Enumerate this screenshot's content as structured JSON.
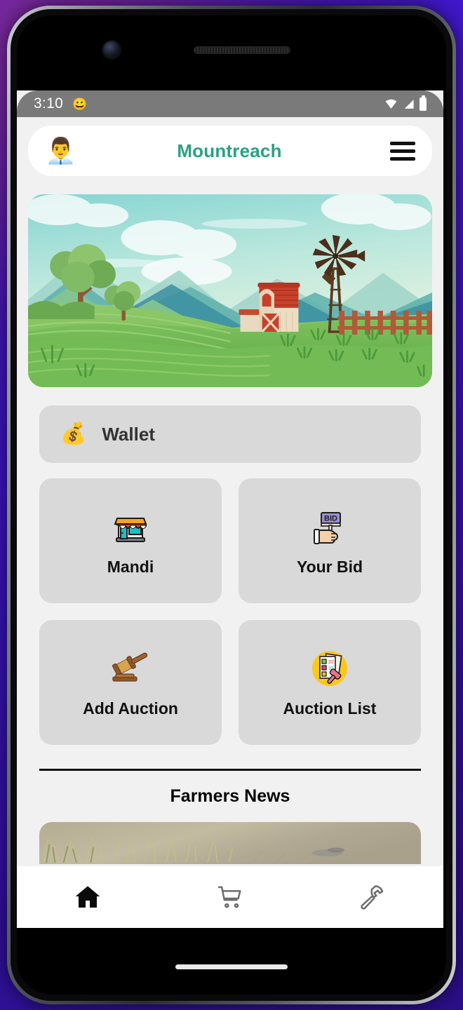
{
  "status_bar": {
    "time": "3:10",
    "notification_icon": "smiley-face-icon",
    "icons": [
      "wifi-icon",
      "cellular-signal-icon",
      "battery-icon"
    ]
  },
  "app_bar": {
    "avatar_icon": "businessman-avatar-icon",
    "avatar_emoji": "👨‍💼",
    "title": "Mountreach",
    "title_color": "#2aa183",
    "menu_icon": "hamburger-menu-icon"
  },
  "hero": {
    "alt": "farm-landscape-banner",
    "description": "Illustrated farm landscape with barn, windmill, trees, fence and green fields"
  },
  "wallet": {
    "icon": "wallet-icon",
    "emoji": "💰",
    "label": "Wallet"
  },
  "menu_tiles": [
    {
      "label": "Mandi",
      "icon": "storefront-icon",
      "emoji": "🏪"
    },
    {
      "label": "Your Bid",
      "icon": "bid-paddle-icon",
      "emoji": "🔨"
    },
    {
      "label": "Add Auction",
      "icon": "gavel-icon",
      "emoji": "🔨"
    },
    {
      "label": "Auction List",
      "icon": "auction-list-icon",
      "emoji": "📋"
    }
  ],
  "news": {
    "section_title": "Farmers News",
    "card_alt": "dry-grass-field-photo"
  },
  "bottom_nav": [
    {
      "icon": "home-icon",
      "active": true
    },
    {
      "icon": "cart-icon",
      "active": false
    },
    {
      "icon": "hammer-icon",
      "active": false
    }
  ],
  "theme": {
    "accent": "#2aa183",
    "screen_bg": "#f1f1f1",
    "tile_bg": "#d9d9d9",
    "status_bar_bg": "#7a7a7a",
    "surface": "#ffffff",
    "backdrop": "#3a15c4"
  }
}
